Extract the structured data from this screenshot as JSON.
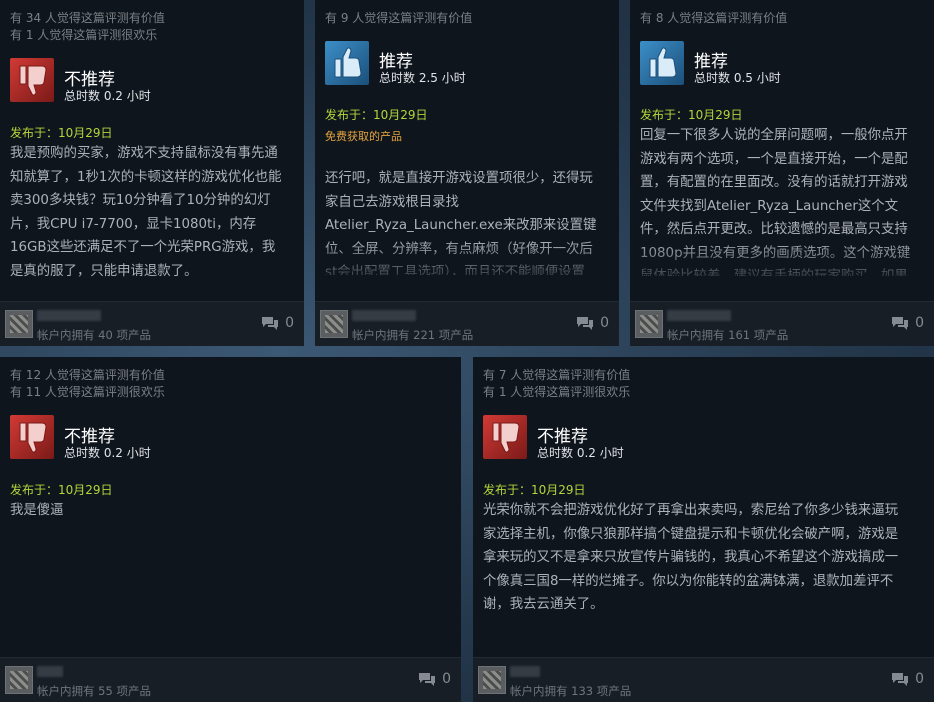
{
  "reviews": [
    {
      "helpful": "有 34 人觉得这篇评测有价值",
      "funny": "有 1 人觉得这篇评测很欢乐",
      "recommended": false,
      "rec_label": "不推荐",
      "hours": "总时数 0.2 小时",
      "posted": "发布于：10月29日",
      "product_type": "",
      "text": "我是预购的买家，游戏不支持鼠标没有事先通\n知就算了，1秒1次的卡顿这样的游戏优化也能\n卖300多块钱？玩10分钟看了10分钟的幻灯\n片，我CPU i7-7700，显卡1080ti，内存\n16GB这些还满足不了一个光荣PRG游戏，我\n是真的服了，只能申请退款了。",
      "owned": "帐户内拥有 40 项产品",
      "comments": "0"
    },
    {
      "helpful": "有 9 人觉得这篇评测有价值",
      "funny": "",
      "recommended": true,
      "rec_label": "推荐",
      "hours": "总时数 2.5 小时",
      "posted": "发布于：10月29日",
      "product_type": "免费获取的产品",
      "text": "还行吧，就是直接开游戏设置项很少，还得玩\n家自己去游戏根目录找\nAtelier_Ryza_Launcher.exe来改那来设置键\n位、全屏、分辨率，有点麻烦（好像开一次后\nst会出配置工具选项），而且还不能顺便设置",
      "owned": "帐户内拥有 221 项产品",
      "comments": "0"
    },
    {
      "helpful": "有 8 人觉得这篇评测有价值",
      "funny": "",
      "recommended": true,
      "rec_label": "推荐",
      "hours": "总时数 0.5 小时",
      "posted": "发布于：10月29日",
      "product_type": "",
      "text": "回复一下很多人说的全屏问题啊，一般你点开\n游戏有两个选项，一个是直接开始，一个是配\n置，有配置的在里面改。没有的话就打开游戏\n文件夹找到Atelier_Ryza_Launcher这个文\n件，然后点开更改。比较遗憾的是最高只支持\n1080p并且没有更多的画质选项。这个游戏键\n鼠体验比较差，建议有手柄的玩家购买。如果",
      "owned": "帐户内拥有 161 项产品",
      "comments": "0"
    },
    {
      "helpful": "有 12 人觉得这篇评测有价值",
      "funny": "有 11 人觉得这篇评测很欢乐",
      "recommended": false,
      "rec_label": "不推荐",
      "hours": "总时数 0.2 小时",
      "posted": "发布于：10月29日",
      "product_type": "",
      "text": "我是傻逼",
      "owned": "帐户内拥有 55 项产品",
      "comments": "0"
    },
    {
      "helpful": "有 7 人觉得这篇评测有价值",
      "funny": "有 1 人觉得这篇评测很欢乐",
      "recommended": false,
      "rec_label": "不推荐",
      "hours": "总时数 0.2 小时",
      "posted": "发布于：10月29日",
      "product_type": "",
      "text": "光荣你就不会把游戏优化好了再拿出来卖吗，索尼给了你多少钱来逼玩\n家选择主机，你像只狼那样搞个键盘提示和卡顿优化会破产啊，游戏是\n拿来玩的又不是拿来只放宣传片骗钱的，我真心不希望这个游戏搞成一\n个像真三国8一样的烂摊子。你以为你能转的盆满钵满，退款加差评不\n谢，我去云通关了。",
      "owned": "帐户内拥有 133 项产品",
      "comments": "0"
    }
  ],
  "colors": {
    "card_bg": "#0f151c",
    "thumb_down": "#d23a35",
    "thumb_up": "#3c8fc8",
    "posted": "#b6d43c",
    "product_type": "#e4a53e"
  },
  "icons": {
    "thumb_down": "thumbs-down-icon",
    "thumb_up": "thumbs-up-icon",
    "comment": "comment-bubble-icon"
  }
}
